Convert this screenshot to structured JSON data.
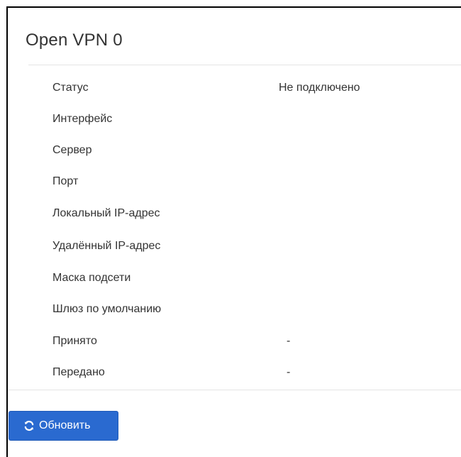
{
  "panel": {
    "title": "Open VPN 0"
  },
  "info": {
    "rows": [
      {
        "label": "Статус",
        "value": "Не подключено"
      },
      {
        "label": "Интерфейс",
        "value": ""
      },
      {
        "label": "Сервер",
        "value": ""
      },
      {
        "label": "Порт",
        "value": ""
      },
      {
        "label": "Локальный IP-адрес",
        "value": ""
      },
      {
        "label": "Удалённый IP-адрес",
        "value": ""
      },
      {
        "label": "Маска подсети",
        "value": ""
      },
      {
        "label": "Шлюз по умолчанию",
        "value": ""
      },
      {
        "label": "Принято",
        "value": "-"
      },
      {
        "label": "Передано",
        "value": "-"
      }
    ]
  },
  "actions": {
    "refresh_label": "Обновить",
    "refresh_icon": "refresh-icon"
  },
  "colors": {
    "accent": "#2a6ad0",
    "text": "#333333",
    "divider": "#e5e5e5"
  }
}
